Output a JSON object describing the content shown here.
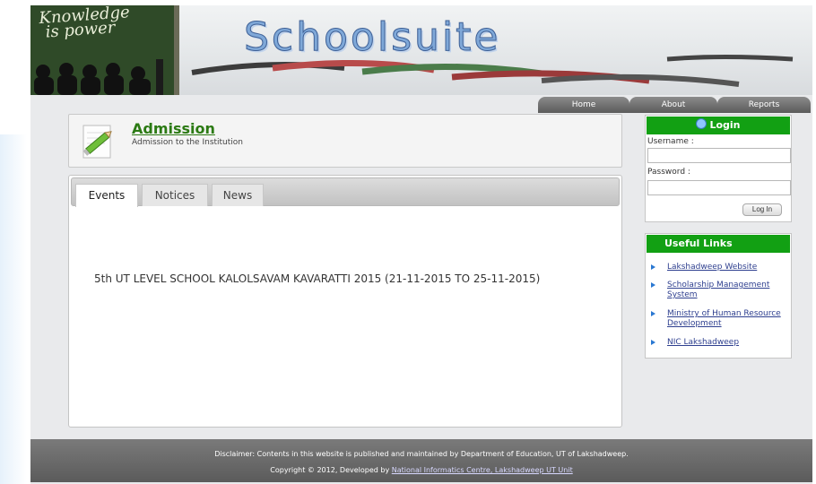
{
  "banner": {
    "chalk_text": "Knowledge is power",
    "title": "Schoolsuite"
  },
  "nav": {
    "home": "Home",
    "about": "About",
    "reports": "Reports"
  },
  "admission": {
    "title": "Admission",
    "subtitle": "Admission to the Institution"
  },
  "tabs": {
    "events": "Events",
    "notices": "Notices",
    "news": "News",
    "active": "Events"
  },
  "events": [
    "5th UT LEVEL SCHOOL KALOLSAVAM KAVARATTI 2015 (21-11-2015 TO 25-11-2015)"
  ],
  "login": {
    "title": "Login",
    "username_label": "Username :",
    "password_label": "Password :",
    "button": "Log In"
  },
  "useful_links": {
    "title": "Useful Links",
    "items": [
      "Lakshadweep Website",
      "Scholarship Management System",
      "Ministry of Human Resource Development",
      "NIC Lakshadweep"
    ]
  },
  "footer": {
    "disclaimer": "Disclaimer: Contents in this website is published and maintained by Department of Education, UT of Lakshadweep.",
    "copyright_prefix": "Copyright © 2012, Developed by",
    "developer_link": "National Informatics Centre, Lakshadweep UT Unit"
  },
  "colors": {
    "accent_green": "#12a013",
    "title_green": "#2b7a13",
    "nav_gray": "#6b6b6b",
    "link_blue": "#2e3f8f"
  }
}
